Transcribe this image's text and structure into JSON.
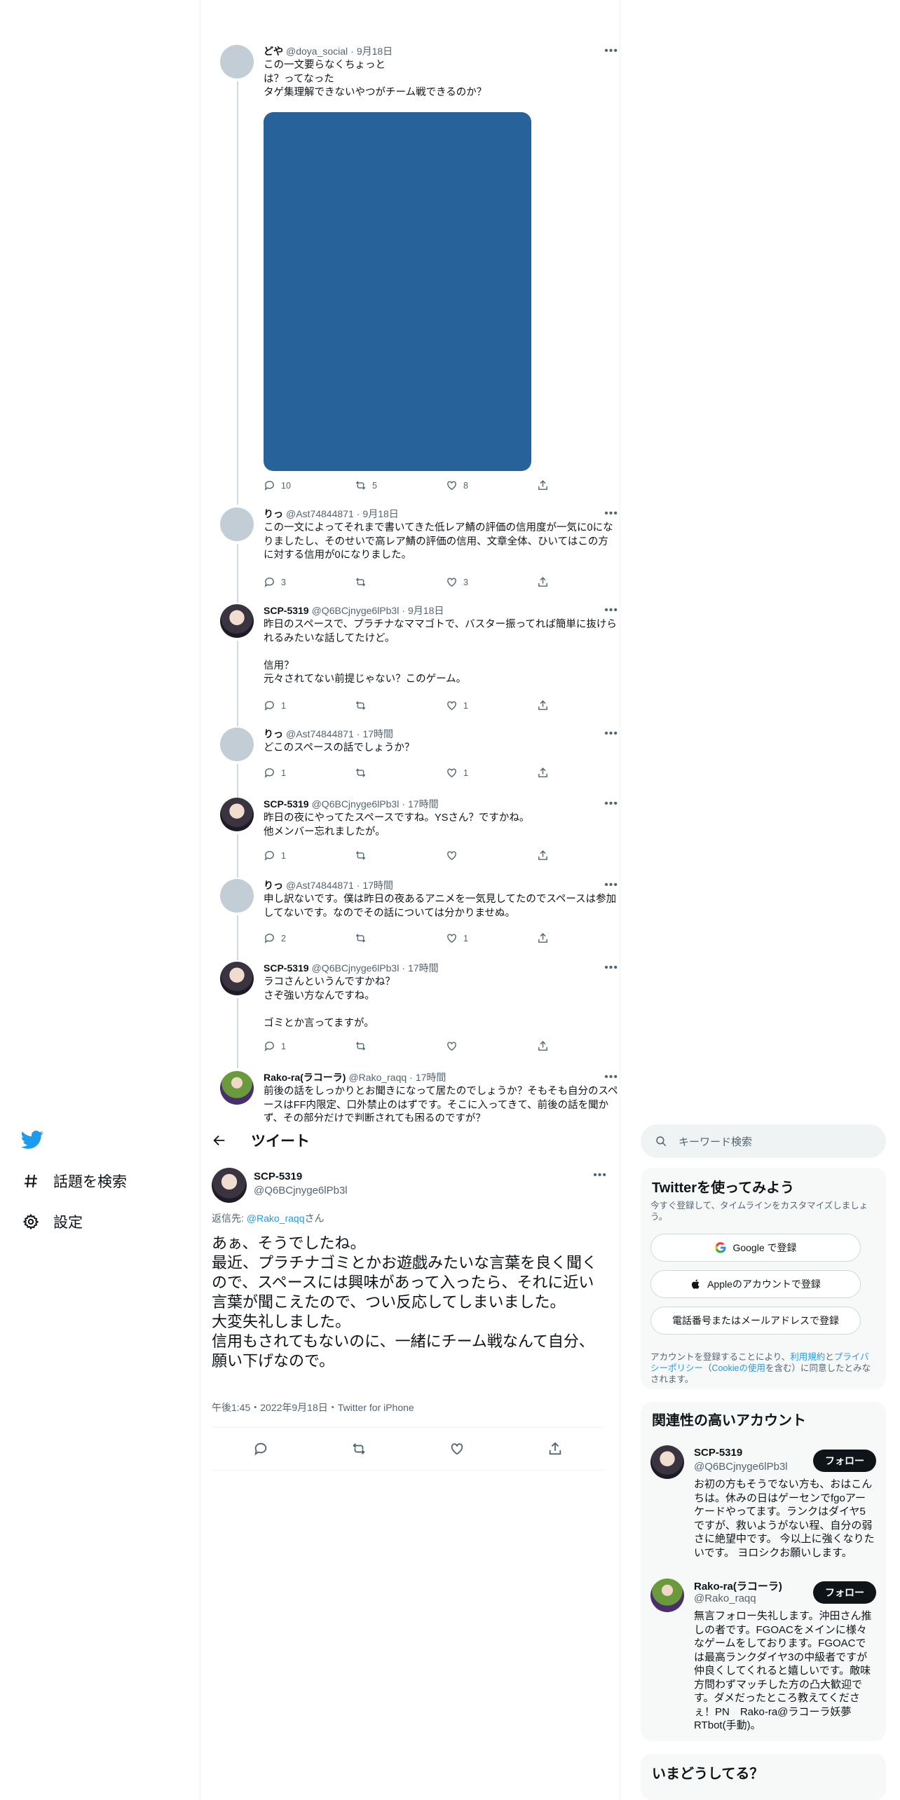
{
  "nav": {
    "items": [
      {
        "label": "話題を検索",
        "icon": "hash-icon"
      },
      {
        "label": "設定",
        "icon": "gear-icon"
      }
    ]
  },
  "thread": [
    {
      "name": "どや",
      "handle": "@doya_social",
      "time": "9月18日",
      "text": "この一文要らなくちょっと\nは？ってなった\nタゲ集理解できないやつがチーム戦できるのか？",
      "has_media": true,
      "replies": "10",
      "retweets": "5",
      "likes": "8"
    },
    {
      "name": "りっ",
      "handle": "@Ast74844871",
      "time": "9月18日",
      "text": "この一文によってそれまで書いてきた低レア鯖の評価の信用度が一気に0になりましたし、そのせいで高レア鯖の評価の信用、文章全体、ひいてはこの方に対する信用が0になりました。",
      "replies": "3",
      "retweets": "",
      "likes": "3"
    },
    {
      "name": "SCP-5319",
      "handle": "@Q6BCjnyge6lPb3l",
      "time": "9月18日",
      "text": "昨日のスペースで、プラチナなママゴトで、バスター振ってれば簡単に抜けられるみたいな話してたけど。\n\n信用？\n元々されてない前提じゃない？このゲーム。",
      "replies": "1",
      "retweets": "",
      "likes": "1"
    },
    {
      "name": "りっ",
      "handle": "@Ast74844871",
      "time": "17時間",
      "text": "どこのスペースの話でしょうか？",
      "replies": "1",
      "retweets": "",
      "likes": "1"
    },
    {
      "name": "SCP-5319",
      "handle": "@Q6BCjnyge6lPb3l",
      "time": "17時間",
      "text": "昨日の夜にやってたスペースですね。YSさん？ですかね。\n他メンバー忘れましたが。",
      "replies": "1",
      "retweets": "",
      "likes": ""
    },
    {
      "name": "りっ",
      "handle": "@Ast74844871",
      "time": "17時間",
      "text": "申し訳ないです。僕は昨日の夜あるアニメを一気見してたのでスペースは参加してないです。なのでその話については分かりませぬ。",
      "replies": "2",
      "retweets": "",
      "likes": "1"
    },
    {
      "name": "SCP-5319",
      "handle": "@Q6BCjnyge6lPb3l",
      "time": "17時間",
      "text": "ラコさんというんですかね？\nさぞ強い方なんですね。\n\nゴミとか言ってますが。",
      "replies": "1",
      "retweets": "",
      "likes": ""
    },
    {
      "name": "Rako-ra(ラコーラ)",
      "handle": "@Rako_raqq",
      "time": "17時間",
      "text": "前後の話をしっかりとお聞きになって居たのでしょうか？そもそも自分のスペースはFF内限定、口外禁止のはずです。そこに入ってきて、前後の話を聞かず、その部分だけで判断されても困るのですが？"
    }
  ],
  "main": {
    "header_title": "ツイート",
    "name": "SCP-5319",
    "handle": "@Q6BCjnyge6lPb3l",
    "reply_prefix": "返信先: ",
    "reply_to": "@Rako_raqq",
    "reply_suffix": "さん",
    "text": "あぁ、そうでしたね。\n最近、プラチナゴミとかお遊戯みたいな言葉を良く聞くので、スペースには興味があって入ったら、それに近い言葉が聞こえたので、つい反応してしまいました。\n大変失礼しました。\n信用もされてもないのに、一緒にチーム戦なんて自分、願い下げなので。",
    "meta": "午後1:45・2022年9月18日・Twitter for iPhone"
  },
  "sidebar": {
    "search_placeholder": "キーワード検索",
    "signup": {
      "title": "Twitterを使ってみよう",
      "subtitle": "今すぐ登録して、タイムラインをカスタマイズしましょう。",
      "google": "Google で登録",
      "apple": "Appleのアカウントで登録",
      "phone": "電話番号またはメールアドレスで登録",
      "legal_1": "アカウントを登録することにより、",
      "legal_terms": "利用規約",
      "legal_2": "と",
      "legal_privacy": "プライバシーポリシー",
      "legal_3": "（",
      "legal_cookie": "Cookieの使用",
      "legal_4": "を含む）に同意したとみなされます。"
    },
    "related": {
      "title": "関連性の高いアカウント",
      "accounts": [
        {
          "name": "SCP-5319",
          "handle": "@Q6BCjnyge6lPb3l",
          "follow": "フォロー",
          "bio": "お初の方もそうでない方も、おはこんちは。休みの日はゲーセンでfgoアーケードやってます。ランクはダイヤ5ですが、救いようがない程、自分の弱さに絶望中です。 今以上に強くなりたいです。 ヨロシクお願いします。"
        },
        {
          "name": "Rako-ra(ラコーラ)",
          "handle": "@Rako_raqq",
          "follow": "フォロー",
          "bio": "無言フォロー失礼します。沖田さん推しの者です。FGOACをメインに様々なゲームをしております。FGOACでは最高ランクダイヤ3の中級者ですが仲良くしてくれると嬉しいです。敵味方問わずマッチした方の凸大歓迎です。ダメだったところ教えてくださぇ！PN　Rako-ra@ラコーラ妖夢RTbot(手動)。"
        }
      ]
    },
    "whats_happening": "いまどうしてる？"
  },
  "colors": {
    "accent": "#1d9bf0",
    "text": "#0f1419",
    "muted": "#536471",
    "media": "#27639a"
  }
}
